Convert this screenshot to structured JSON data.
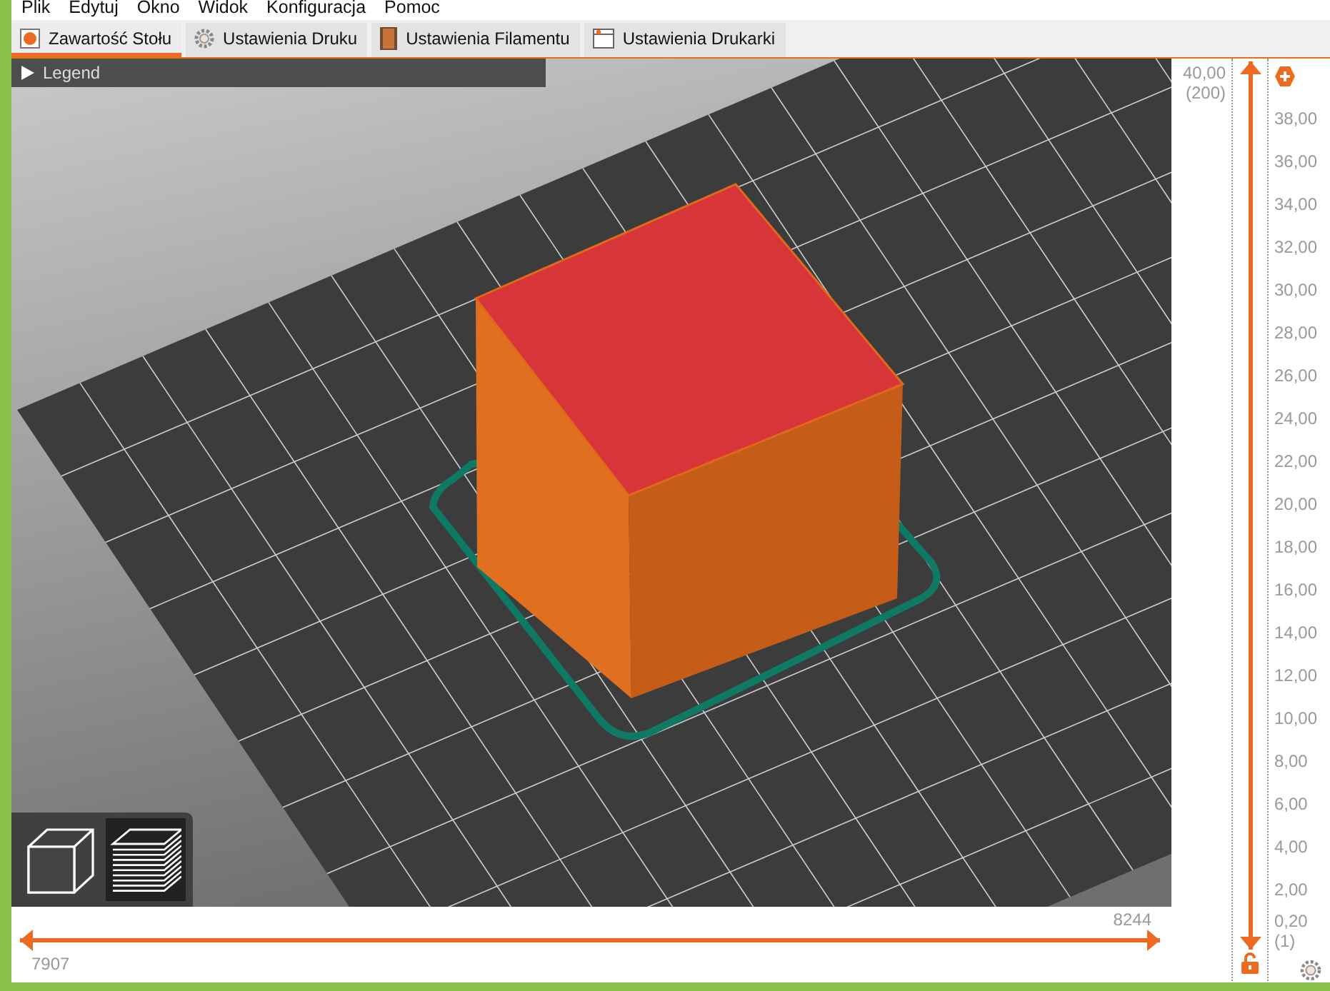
{
  "menu": [
    "Plik",
    "Edytuj",
    "Okno",
    "Widok",
    "Konfiguracja",
    "Pomoc"
  ],
  "tabs": [
    {
      "label": "Zawartość Stołu",
      "selected": true,
      "kind": "plater"
    },
    {
      "label": "Ustawienia Druku",
      "selected": false,
      "kind": "print"
    },
    {
      "label": "Ustawienia Filamentu",
      "selected": false,
      "kind": "filament"
    },
    {
      "label": "Ustawienia Drukarki",
      "selected": false,
      "kind": "printer"
    }
  ],
  "legend": {
    "label": "Legend",
    "expanded": false
  },
  "view_toggle": [
    {
      "kind": "solid",
      "selected": false
    },
    {
      "kind": "layers",
      "selected": true
    }
  ],
  "vertical_slider": {
    "top_value": "40,00",
    "top_layer": "(200)",
    "scale": [
      "38,00",
      "36,00",
      "34,00",
      "32,00",
      "30,00",
      "28,00",
      "26,00",
      "24,00",
      "22,00",
      "20,00",
      "18,00",
      "16,00",
      "14,00",
      "12,00",
      "10,00",
      "8,00",
      "6,00",
      "4,00",
      "2,00"
    ],
    "bottom_value": "0,20",
    "bottom_layer": "(1)",
    "upper_thumb": {
      "level": 1
    },
    "lower_thumb": {
      "level": 0
    }
  },
  "horizontal_slider": {
    "left_value": "7907",
    "right_value": "8244",
    "left_thumb": {
      "level": 0
    },
    "right_thumb": {
      "level": 1
    }
  }
}
